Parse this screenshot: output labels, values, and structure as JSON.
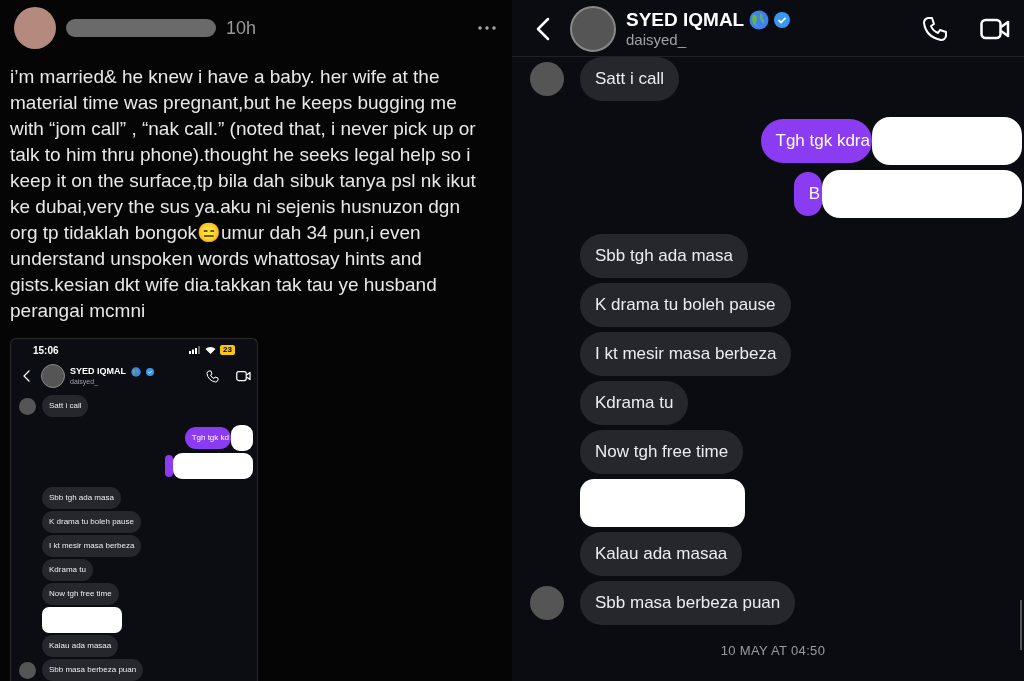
{
  "post": {
    "time": "10h",
    "text": "i’m married& he knew i have a baby. her wife at the material time was pregnant,but he keeps bugging me with “jom call” , “nak call.” (noted that, i never pick up or talk to him thru phone).thought he seeks legal help so i keep it on the surface,tp bila dah sibuk tanya psl nk ikut ke dubai,very the sus ya.aku ni sejenis husnuzon dgn org tp tidaklah bongok😑umur dah 34 pun,i even understand unspoken words whattosay hints and gists.kesian dkt wife dia.takkan tak tau ye husband perangai mcmni"
  },
  "inner_chat": {
    "status_time": "15:06",
    "battery": "23",
    "contact": {
      "name": "SYED IQMAL",
      "handle": "daisyed_"
    },
    "messages": [
      {
        "kind": "received",
        "text": "Satt i call",
        "avatar": true
      },
      {
        "kind": "sent",
        "text": "Tgh tgk kd",
        "redacted": true
      },
      {
        "kind": "sent",
        "redacted": true
      },
      {
        "kind": "received",
        "text": "Sbb tgh ada masa",
        "avatar": false
      },
      {
        "kind": "received",
        "text": "K drama tu boleh pause",
        "avatar": false
      },
      {
        "kind": "received",
        "text": "I kt mesir masa berbeza",
        "avatar": false
      },
      {
        "kind": "received",
        "text": "Kdrama tu",
        "avatar": false
      },
      {
        "kind": "received",
        "text": "Now tgh free time",
        "avatar": false
      },
      {
        "kind": "received",
        "redacted": true,
        "avatar": false
      },
      {
        "kind": "received",
        "text": "Kalau ada masaa",
        "avatar": false
      },
      {
        "kind": "received",
        "text": "Sbb masa berbeza puan",
        "avatar": true
      }
    ]
  },
  "chat": {
    "contact": {
      "name": "SYED IQMAL",
      "handle": "daisyed_"
    },
    "messages": [
      {
        "kind": "received",
        "text": "Satt i call",
        "avatar": true
      },
      {
        "kind": "sent",
        "text": "Tgh tgk kdra",
        "redacted": true
      },
      {
        "kind": "sent",
        "text": "B",
        "redacted": true
      },
      {
        "kind": "received",
        "text": "Sbb tgh ada masa",
        "avatar": false
      },
      {
        "kind": "received",
        "text": "K drama tu boleh pause",
        "avatar": false
      },
      {
        "kind": "received",
        "text": "I kt mesir masa berbeza",
        "avatar": false
      },
      {
        "kind": "received",
        "text": "Kdrama tu",
        "avatar": false
      },
      {
        "kind": "received",
        "text": "Now tgh free time",
        "avatar": false
      },
      {
        "kind": "received",
        "redacted": true,
        "avatar": false
      },
      {
        "kind": "received",
        "text": "Kalau ada masaa",
        "avatar": false
      },
      {
        "kind": "received",
        "text": "Sbb masa berbeza puan",
        "avatar": true
      }
    ],
    "timestamp": "10 MAY AT 04:50"
  }
}
